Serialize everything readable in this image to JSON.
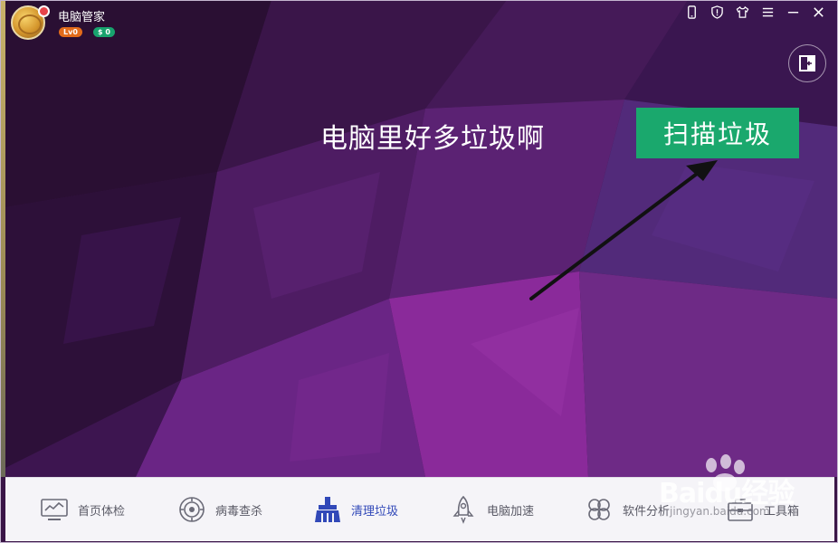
{
  "app": {
    "title": "电脑管家",
    "level_badge": "Lv0",
    "vip_badge": "$ 0"
  },
  "titlebar": {
    "icons": [
      "phone-icon",
      "shield-icon",
      "tshirt-skin-icon",
      "menu-icon",
      "minimize-icon",
      "close-icon"
    ]
  },
  "side_button": {
    "icon": "exit-panel-icon"
  },
  "main": {
    "headline": "电脑里好多垃圾啊",
    "scan_button_label": "扫描垃圾",
    "accent_color": "#1aa86d"
  },
  "nav": {
    "items": [
      {
        "label": "首页体检",
        "icon": "monitor-checkup-icon",
        "active": false
      },
      {
        "label": "病毒查杀",
        "icon": "virus-scan-icon",
        "active": false
      },
      {
        "label": "清理垃圾",
        "icon": "broom-clean-icon",
        "active": true
      },
      {
        "label": "电脑加速",
        "icon": "rocket-speedup-icon",
        "active": false
      },
      {
        "label": "软件分析",
        "icon": "clover-software-icon",
        "active": false
      },
      {
        "label": "工具箱",
        "icon": "toolbox-icon",
        "active": false
      }
    ],
    "active_color": "#3148b8"
  },
  "watermark": {
    "text": "Baidu经验",
    "url": "jingyan.baidu.com"
  }
}
